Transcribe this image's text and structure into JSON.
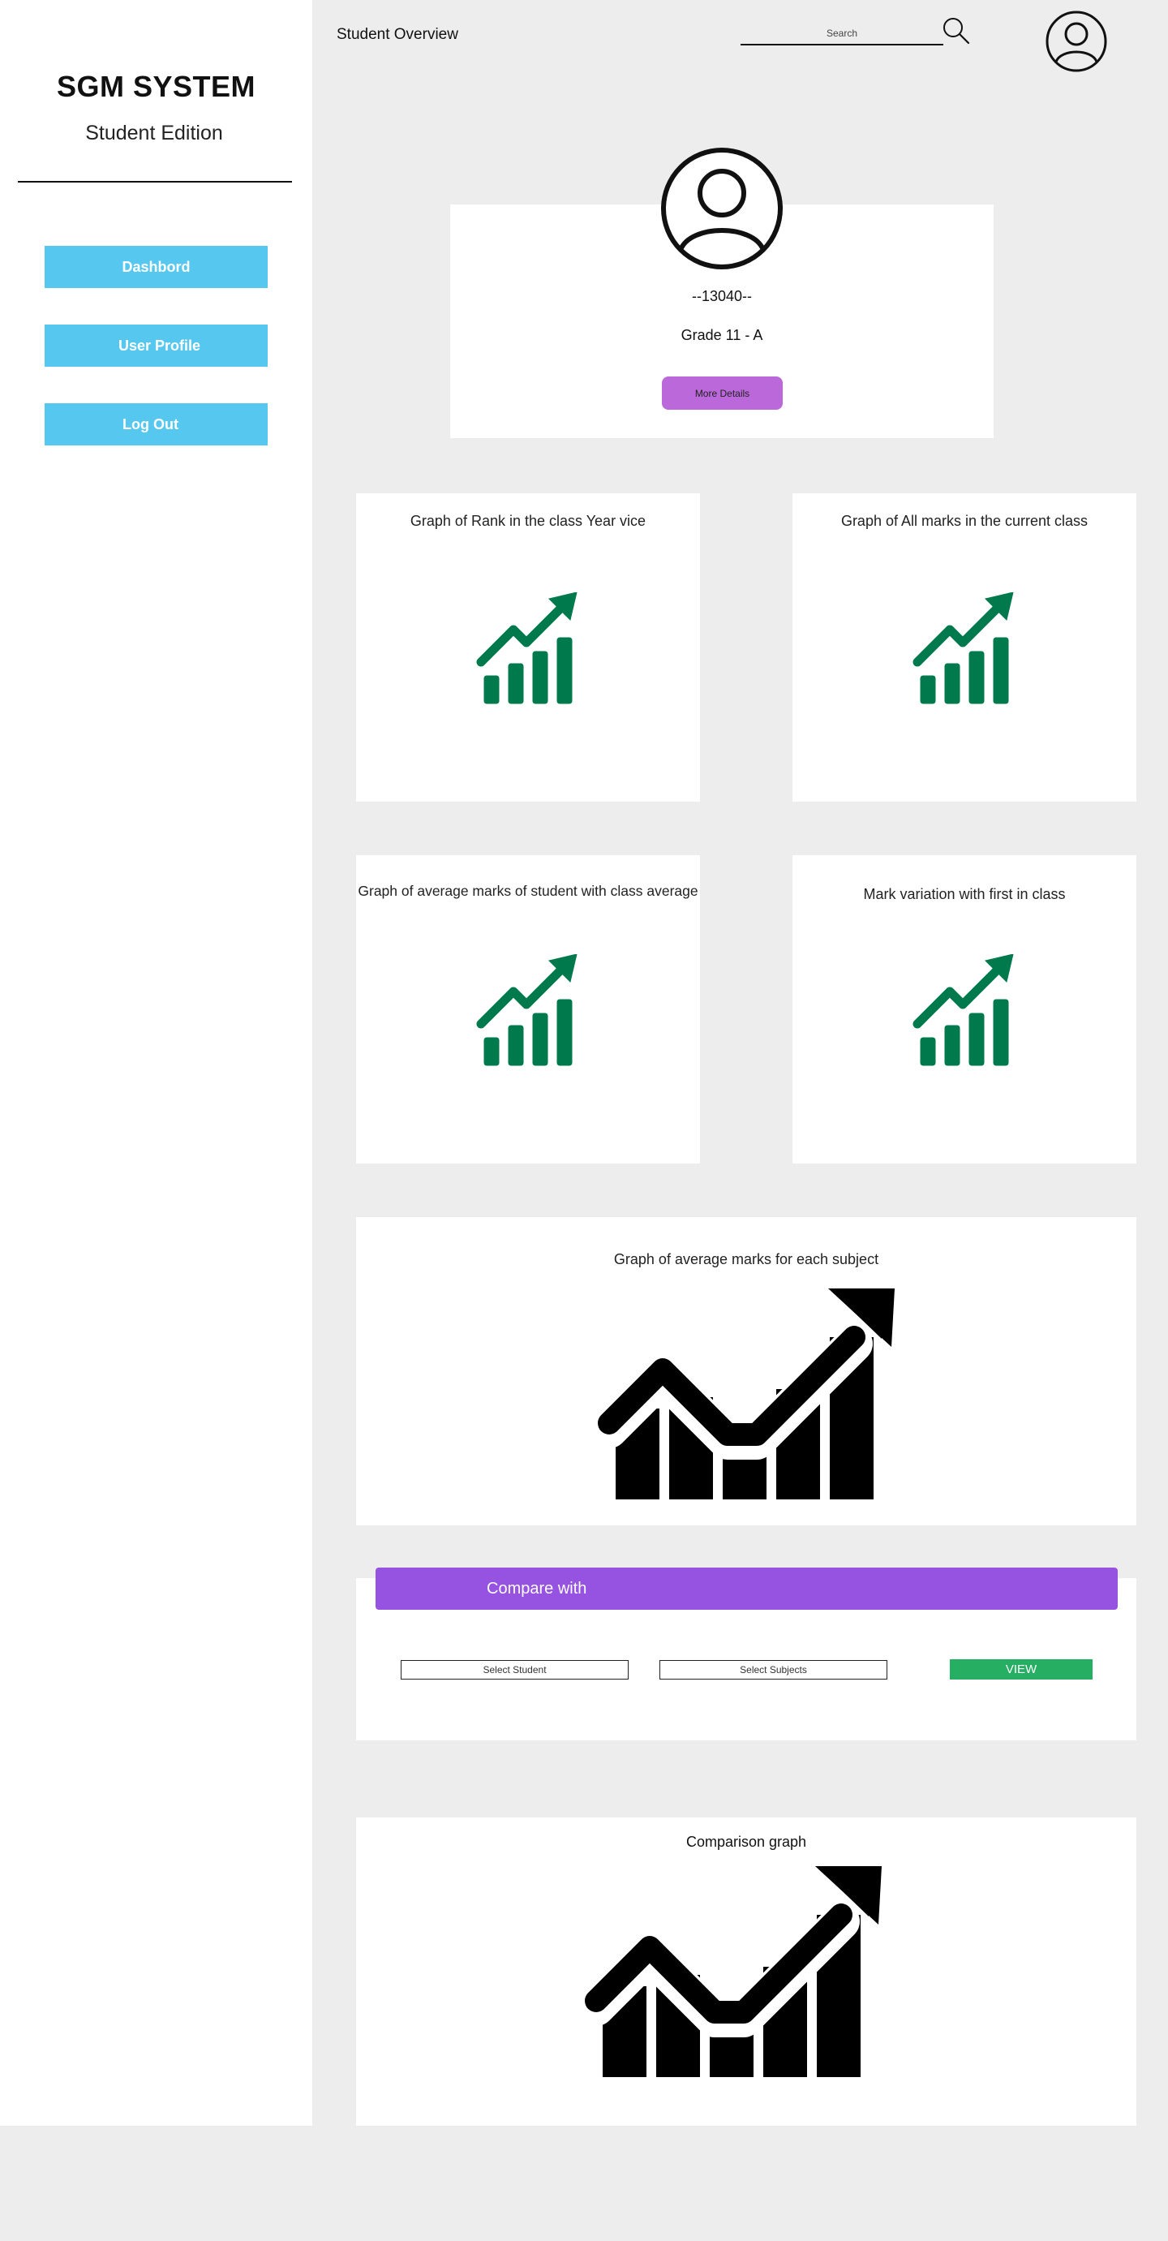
{
  "sidebar": {
    "brand_title": "SGM SYSTEM",
    "brand_subtitle": "Student Edition",
    "nav": {
      "dashboard": "Dashbord",
      "user_profile": "User Profile",
      "logout": "Log Out"
    }
  },
  "topbar": {
    "title": "Student Overview",
    "search_placeholder": "Search",
    "icons": {
      "search": "search-icon",
      "avatar": "user-avatar-icon"
    }
  },
  "profile": {
    "student_id": "--13040--",
    "grade": "Grade 11 - A",
    "more_details_label": "More Details"
  },
  "graphs": {
    "rank_year_wise": "Graph of Rank in the class Year vice",
    "all_marks_current": "Graph of All marks in the current class",
    "avg_vs_class": "Graph of average marks of student with class average",
    "variation_first": "Mark variation with first in class",
    "avg_per_subject": "Graph of average marks for each subject"
  },
  "compare": {
    "header": "Compare with",
    "select_student": "Select Student",
    "select_subjects": "Select Subjects",
    "view_label": "VIEW"
  },
  "comparison": {
    "title": "Comparison graph"
  },
  "colors": {
    "nav_button": "#56c8f0",
    "more_details": "#bb68da",
    "compare_header": "#9652e0",
    "view_button": "#26ae63",
    "chart_icon_green": "#007a4d",
    "page_background": "#ededed"
  }
}
